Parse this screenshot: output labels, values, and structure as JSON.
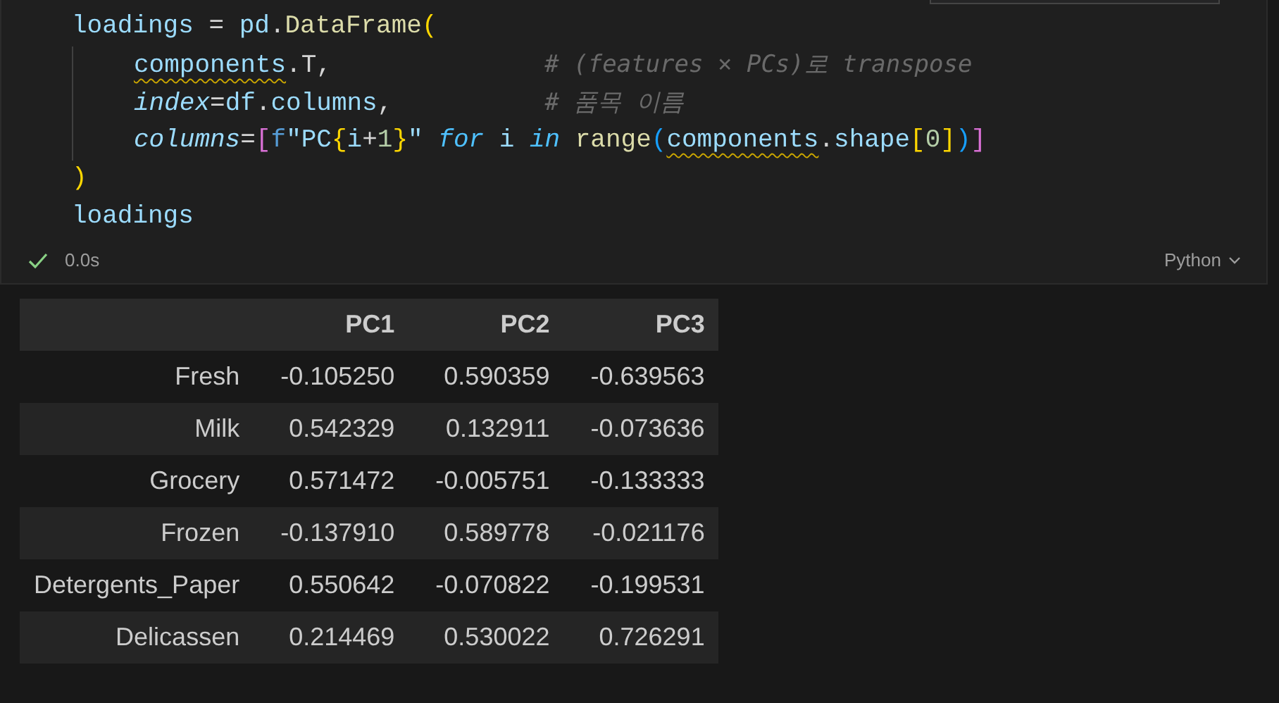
{
  "code_cell": {
    "lines": [
      {
        "tokens": [
          {
            "text": "loadings",
            "kind": "var"
          },
          {
            "text": " = ",
            "kind": "op"
          },
          {
            "text": "pd",
            "kind": "var"
          },
          {
            "text": ".",
            "kind": "op"
          },
          {
            "text": "DataFrame",
            "kind": "func"
          },
          {
            "text": "(",
            "kind": "b1"
          }
        ],
        "children": [
          {
            "tokens": [
              {
                "text": "components",
                "kind": "var",
                "warning": true
              },
              {
                "text": ".T,              ",
                "kind": "op"
              },
              {
                "text": "# (features × PCs)로 transpose",
                "kind": "comment"
              }
            ]
          },
          {
            "tokens": [
              {
                "text": "index",
                "kind": "param"
              },
              {
                "text": "=",
                "kind": "op"
              },
              {
                "text": "df",
                "kind": "var"
              },
              {
                "text": ".",
                "kind": "op"
              },
              {
                "text": "columns",
                "kind": "var"
              },
              {
                "text": ",          ",
                "kind": "op"
              },
              {
                "text": "# 품목 이름",
                "kind": "comment"
              }
            ]
          },
          {
            "tokens": [
              {
                "text": "columns",
                "kind": "param"
              },
              {
                "text": "=",
                "kind": "op"
              },
              {
                "text": "[",
                "kind": "b2"
              },
              {
                "text": "f",
                "kind": "storage"
              },
              {
                "text": "\"PC",
                "kind": "string"
              },
              {
                "text": "{",
                "kind": "b1"
              },
              {
                "text": "i",
                "kind": "var"
              },
              {
                "text": "+",
                "kind": "op"
              },
              {
                "text": "1",
                "kind": "number"
              },
              {
                "text": "}",
                "kind": "b1"
              },
              {
                "text": "\" ",
                "kind": "string"
              },
              {
                "text": "for",
                "kind": "keyword"
              },
              {
                "text": " i ",
                "kind": "var"
              },
              {
                "text": "in",
                "kind": "keyword"
              },
              {
                "text": " range",
                "kind": "func"
              },
              {
                "text": "(",
                "kind": "b3"
              },
              {
                "text": "components",
                "kind": "var",
                "warning": true
              },
              {
                "text": ".",
                "kind": "op"
              },
              {
                "text": "shape",
                "kind": "var"
              },
              {
                "text": "[",
                "kind": "b1"
              },
              {
                "text": "0",
                "kind": "number"
              },
              {
                "text": "]",
                "kind": "b1"
              },
              {
                "text": ")",
                "kind": "b3"
              },
              {
                "text": "]",
                "kind": "b2"
              }
            ]
          }
        ]
      },
      {
        "tokens": [
          {
            "text": ")",
            "kind": "b1"
          }
        ]
      },
      {
        "tokens": [
          {
            "text": "loadings",
            "kind": "var"
          }
        ]
      }
    ],
    "status": {
      "succeeded": true,
      "duration": "0.0s",
      "language": "Python"
    }
  },
  "output_table": {
    "columns": [
      "PC1",
      "PC2",
      "PC3"
    ],
    "rows": [
      {
        "index": "Fresh",
        "cells": [
          "-0.105250",
          "0.590359",
          "-0.639563"
        ]
      },
      {
        "index": "Milk",
        "cells": [
          "0.542329",
          "0.132911",
          "-0.073636"
        ]
      },
      {
        "index": "Grocery",
        "cells": [
          "0.571472",
          "-0.005751",
          "-0.133333"
        ]
      },
      {
        "index": "Frozen",
        "cells": [
          "-0.137910",
          "0.589778",
          "-0.021176"
        ]
      },
      {
        "index": "Detergents_Paper",
        "cells": [
          "0.550642",
          "-0.070822",
          "-0.199531"
        ]
      },
      {
        "index": "Delicassen",
        "cells": [
          "0.214469",
          "0.530022",
          "0.726291"
        ]
      }
    ]
  }
}
